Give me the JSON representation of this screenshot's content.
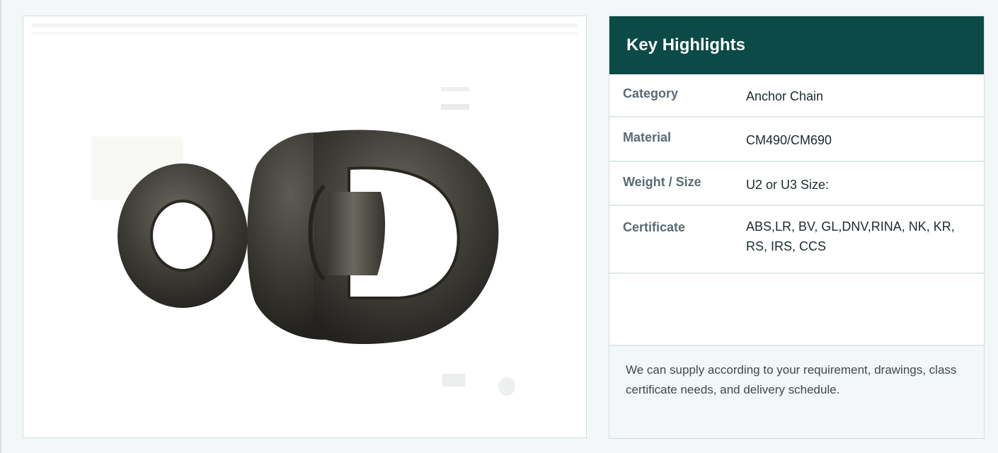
{
  "product_image": {
    "alt": "Swivel"
  },
  "key_highlights": {
    "title": "Key Highlights",
    "rows": [
      {
        "label": "Category",
        "value": "Anchor Chain"
      },
      {
        "label": "Material",
        "value": "CM490/CM690"
      },
      {
        "label": "Weight / Size",
        "value": "U2 or U3 Size:"
      },
      {
        "label": "Certificate",
        "value": "ABS,LR, BV, GL,DNV,RINA, NK, KR, RS, IRS, CCS"
      },
      {
        "label": "",
        "value": ""
      }
    ],
    "note": "We can supply according to your requirement, drawings, class certificate needs, and delivery schedule."
  },
  "colors": {
    "header_bg": "#0b4a47",
    "label_text": "#5a6b73",
    "value_text": "#1d2a2f",
    "page_bg": "#f3f7f7"
  }
}
